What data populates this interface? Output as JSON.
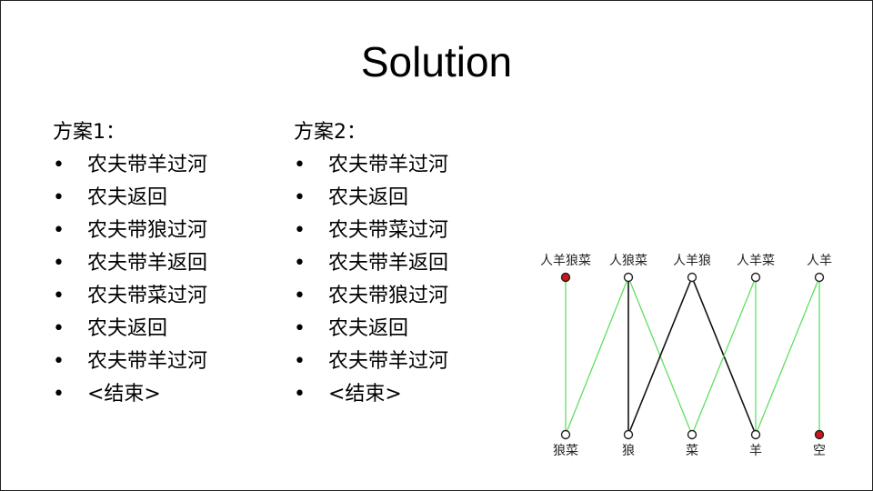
{
  "title": "Solution",
  "plans": [
    {
      "heading": "方案1：",
      "steps": [
        "农夫带羊过河",
        "农夫返回",
        "农夫带狼过河",
        "农夫带羊返回",
        "农夫带菜过河",
        "农夫返回",
        "农夫带羊过河",
        "<结束>"
      ]
    },
    {
      "heading": "方案2：",
      "steps": [
        "农夫带羊过河",
        "农夫返回",
        "农夫带菜过河",
        "农夫带羊返回",
        "农夫带狼过河",
        "农夫返回",
        "农夫带羊过河",
        "<结束>"
      ]
    }
  ],
  "bullet": "•",
  "graph": {
    "top_nodes": [
      {
        "id": "t1",
        "label": "人羊狼菜",
        "filled": true
      },
      {
        "id": "t2",
        "label": "人狼菜",
        "filled": false
      },
      {
        "id": "t3",
        "label": "人羊狼",
        "filled": false
      },
      {
        "id": "t4",
        "label": "人羊菜",
        "filled": false
      },
      {
        "id": "t5",
        "label": "人羊",
        "filled": false
      }
    ],
    "bottom_nodes": [
      {
        "id": "b1",
        "label": "狼菜",
        "filled": false
      },
      {
        "id": "b2",
        "label": "狼",
        "filled": false
      },
      {
        "id": "b3",
        "label": "菜",
        "filled": false
      },
      {
        "id": "b4",
        "label": "羊",
        "filled": false
      },
      {
        "id": "b5",
        "label": "空",
        "filled": true
      }
    ],
    "edges": [
      {
        "from": "t1",
        "to": "b1",
        "color": "green"
      },
      {
        "from": "b1",
        "to": "t2",
        "color": "green"
      },
      {
        "from": "t2",
        "to": "b2",
        "color": "black"
      },
      {
        "from": "t2",
        "to": "b3",
        "color": "green"
      },
      {
        "from": "b2",
        "to": "t3",
        "color": "black"
      },
      {
        "from": "t3",
        "to": "b4",
        "color": "black"
      },
      {
        "from": "b3",
        "to": "t4",
        "color": "green"
      },
      {
        "from": "t4",
        "to": "b4",
        "color": "green"
      },
      {
        "from": "b4",
        "to": "t5",
        "color": "green"
      },
      {
        "from": "t5",
        "to": "b5",
        "color": "green"
      }
    ],
    "colors": {
      "green": "#5fe05f",
      "black": "#111111",
      "filled": "#d0141a",
      "node_stroke": "#222222"
    }
  }
}
